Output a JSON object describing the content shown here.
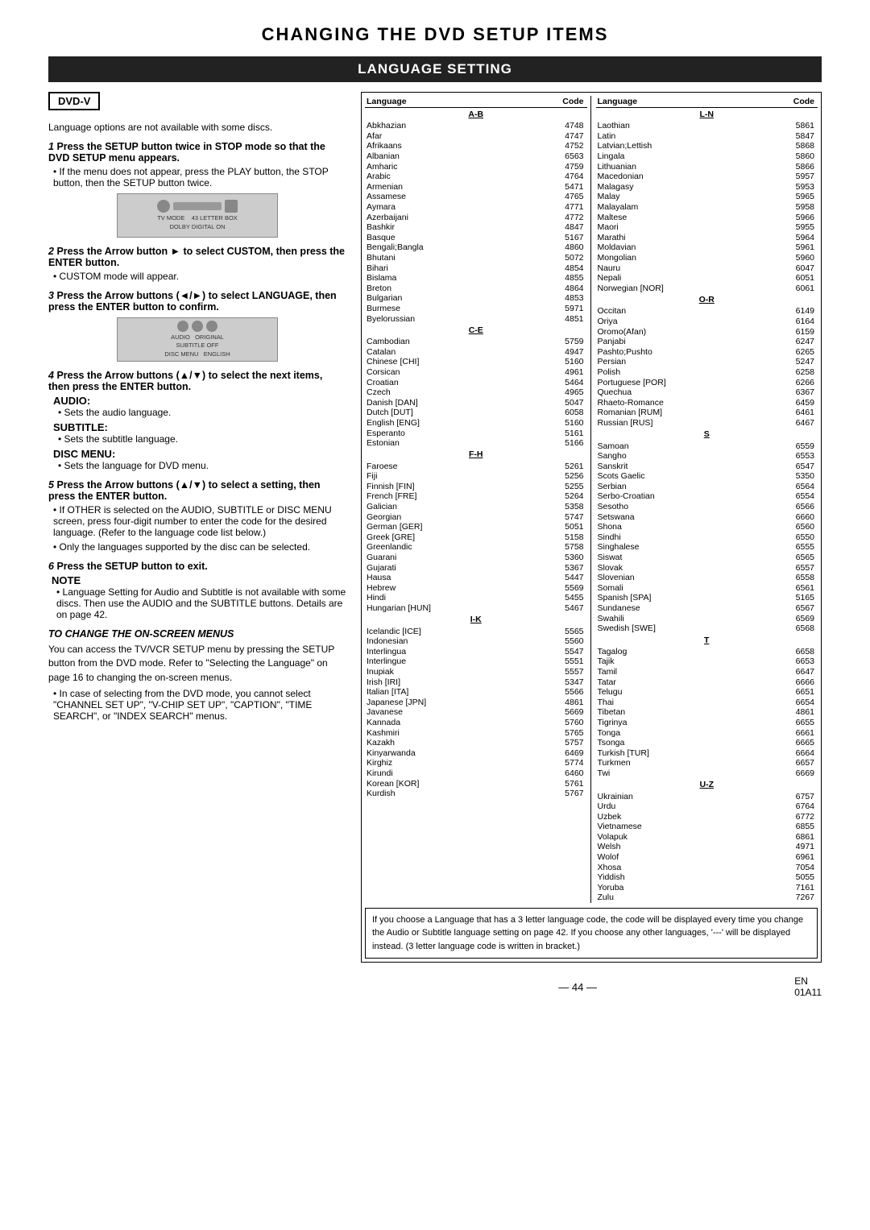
{
  "title": "CHANGING THE DVD SETUP ITEMS",
  "subtitle": "LANGUAGE SETTING",
  "dvd_badge": "DVD-V",
  "instruction_note": "Language options are not available with some discs.",
  "steps": [
    {
      "number": "1",
      "text": "Press the SETUP button twice in STOP mode so that the DVD SETUP menu appears.",
      "bullets": [
        "If the menu does not appear, press the PLAY button, the STOP button, then the SETUP button twice."
      ],
      "has_device1": true
    },
    {
      "number": "2",
      "text": "Press the Arrow button ► to select CUSTOM, then press the ENTER button.",
      "bullets": [
        "CUSTOM mode will appear."
      ]
    },
    {
      "number": "3",
      "text": "Press the Arrow buttons (◄/►) to select LANGUAGE, then press the ENTER button to confirm.",
      "has_device2": true
    },
    {
      "number": "4",
      "text": "Press the Arrow buttons (▲/▼) to select the next items, then press the ENTER button.",
      "section_labels": [
        {
          "label": "AUDIO:",
          "text": "Sets the audio language."
        },
        {
          "label": "SUBTITLE:",
          "text": "Sets the subtitle language."
        },
        {
          "label": "DISC MENU:",
          "text": "Sets the language for DVD menu."
        }
      ]
    },
    {
      "number": "5",
      "text": "Press the Arrow buttons (▲/▼) to select a setting, then press the ENTER button.",
      "bullets": [
        "If OTHER is selected on the AUDIO, SUBTITLE or DISC MENU screen, press four-digit number to enter the code for the desired language. (Refer to the language code list below.)",
        "Only the languages supported by the disc can be selected."
      ]
    },
    {
      "number": "6",
      "text": "Press the SETUP button to exit."
    }
  ],
  "note_title": "NOTE",
  "note_text": "Language Setting for Audio and Subtitle is not available with some discs. Then use the AUDIO and the SUBTITLE buttons. Details are on page 42.",
  "to_change_title": "TO CHANGE THE ON-SCREEN MENUS",
  "to_change_text": "You can access the TV/VCR SETUP menu by pressing the SETUP button from the DVD mode. Refer to \"Selecting the Language\" on page 16 to changing the on-screen menus.",
  "to_change_bullets": [
    "In case of selecting from the DVD mode, you cannot select \"CHANNEL SET UP\", \"V-CHIP SET UP\", \"CAPTION\", \"TIME SEARCH\", or \"INDEX SEARCH\" menus."
  ],
  "languages_left": {
    "header_lang": "Language",
    "header_code": "Code",
    "section_ab": "A-B",
    "rows_ab": [
      [
        "Abkhazian",
        "4748"
      ],
      [
        "Afar",
        "4747"
      ],
      [
        "Afrikaans",
        "4752"
      ],
      [
        "Albanian",
        "6563"
      ],
      [
        "Amharic",
        "4759"
      ],
      [
        "Arabic",
        "4764"
      ],
      [
        "Armenian",
        "5471"
      ],
      [
        "Assamese",
        "4765"
      ],
      [
        "Aymara",
        "4771"
      ],
      [
        "Azerbaijani",
        "4772"
      ],
      [
        "Bashkir",
        "4847"
      ],
      [
        "Basque",
        "5167"
      ],
      [
        "Bengali;Bangla",
        "4860"
      ],
      [
        "Bhutani",
        "5072"
      ],
      [
        "Bihari",
        "4854"
      ],
      [
        "Bislama",
        "4855"
      ],
      [
        "Breton",
        "4864"
      ],
      [
        "Bulgarian",
        "4853"
      ],
      [
        "Burmese",
        "5971"
      ],
      [
        "Byelorussian",
        "4851"
      ]
    ],
    "section_ce": "C-E",
    "rows_ce": [
      [
        "Cambodian",
        "5759"
      ],
      [
        "Catalan",
        "4947"
      ],
      [
        "Chinese [CHI]",
        "5160"
      ],
      [
        "Corsican",
        "4961"
      ],
      [
        "Croatian",
        "5464"
      ],
      [
        "Czech",
        "4965"
      ],
      [
        "Danish [DAN]",
        "5047"
      ],
      [
        "Dutch [DUT]",
        "6058"
      ],
      [
        "English [ENG]",
        "5160"
      ],
      [
        "Esperanto",
        "5161"
      ],
      [
        "Estonian",
        "5166"
      ]
    ],
    "section_fh": "F-H",
    "rows_fh": [
      [
        "Faroese",
        "5261"
      ],
      [
        "Fiji",
        "5256"
      ],
      [
        "Finnish [FIN]",
        "5255"
      ],
      [
        "French [FRE]",
        "5264"
      ],
      [
        "Galician",
        "5358"
      ],
      [
        "Georgian",
        "5747"
      ],
      [
        "German [GER]",
        "5051"
      ],
      [
        "Greek [GRE]",
        "5158"
      ],
      [
        "Greenlandic",
        "5758"
      ],
      [
        "Guarani",
        "5360"
      ],
      [
        "Gujarati",
        "5367"
      ],
      [
        "Hausa",
        "5447"
      ],
      [
        "Hebrew",
        "5569"
      ],
      [
        "Hindi",
        "5455"
      ],
      [
        "Hungarian [HUN]",
        "5467"
      ]
    ],
    "section_ik": "I-K",
    "rows_ik": [
      [
        "Icelandic [ICE]",
        "5565"
      ],
      [
        "Indonesian",
        "5560"
      ],
      [
        "Interlingua",
        "5547"
      ],
      [
        "Interlingue",
        "5551"
      ],
      [
        "Inupiak",
        "5557"
      ],
      [
        "Irish [IRI]",
        "5347"
      ],
      [
        "Italian [ITA]",
        "5566"
      ],
      [
        "Japanese [JPN]",
        "4861"
      ],
      [
        "Javanese",
        "5669"
      ],
      [
        "Kannada",
        "5760"
      ],
      [
        "Kashmiri",
        "5765"
      ],
      [
        "Kazakh",
        "5757"
      ],
      [
        "Kinyarwanda",
        "6469"
      ],
      [
        "Kirghiz",
        "5774"
      ],
      [
        "Kirundi",
        "6460"
      ],
      [
        "Korean [KOR]",
        "5761"
      ],
      [
        "Kurdish",
        "5767"
      ]
    ]
  },
  "languages_right": {
    "header_lang": "Language",
    "header_code": "Code",
    "section_ln": "L-N",
    "rows_ln": [
      [
        "Laothian",
        "5861"
      ],
      [
        "Latin",
        "5847"
      ],
      [
        "Latvian;Lettish",
        "5868"
      ],
      [
        "Lingala",
        "5860"
      ],
      [
        "Lithuanian",
        "5866"
      ],
      [
        "Macedonian",
        "5957"
      ],
      [
        "Malagasy",
        "5953"
      ],
      [
        "Malay",
        "5965"
      ],
      [
        "Malayalam",
        "5958"
      ],
      [
        "Maltese",
        "5966"
      ],
      [
        "Maori",
        "5955"
      ],
      [
        "Marathi",
        "5964"
      ],
      [
        "Moldavian",
        "5961"
      ],
      [
        "Mongolian",
        "5960"
      ],
      [
        "Nauru",
        "6047"
      ],
      [
        "Nepali",
        "6051"
      ],
      [
        "Norwegian [NOR]",
        "6061"
      ]
    ],
    "section_or": "O-R",
    "rows_or": [
      [
        "Occitan",
        "6149"
      ],
      [
        "Oriya",
        "6164"
      ],
      [
        "Oromo(Afan)",
        "6159"
      ],
      [
        "Panjabi",
        "6247"
      ],
      [
        "Pashto;Pushto",
        "6265"
      ],
      [
        "Persian",
        "5247"
      ],
      [
        "Polish",
        "6258"
      ],
      [
        "Portuguese [POR]",
        "6266"
      ],
      [
        "Quechua",
        "6367"
      ],
      [
        "Rhaeto-Romance",
        "6459"
      ],
      [
        "Romanian [RUM]",
        "6461"
      ],
      [
        "Russian [RUS]",
        "6467"
      ]
    ],
    "section_s": "S",
    "rows_s": [
      [
        "Samoan",
        "6559"
      ],
      [
        "Sangho",
        "6553"
      ],
      [
        "Sanskrit",
        "6547"
      ],
      [
        "Scots Gaelic",
        "5350"
      ],
      [
        "Serbian",
        "6564"
      ],
      [
        "Serbo-Croatian",
        "6554"
      ],
      [
        "Sesotho",
        "6566"
      ],
      [
        "Setswana",
        "6660"
      ],
      [
        "Shona",
        "6560"
      ],
      [
        "Sindhi",
        "6550"
      ],
      [
        "Singhalese",
        "6555"
      ],
      [
        "Siswat",
        "6565"
      ],
      [
        "Slovak",
        "6557"
      ],
      [
        "Slovenian",
        "6558"
      ],
      [
        "Somali",
        "6561"
      ],
      [
        "Spanish [SPA]",
        "5165"
      ],
      [
        "Sundanese",
        "6567"
      ],
      [
        "Swahili",
        "6569"
      ],
      [
        "Swedish [SWE]",
        "6568"
      ]
    ],
    "section_t": "T",
    "rows_t": [
      [
        "Tagalog",
        "6658"
      ],
      [
        "Tajik",
        "6653"
      ],
      [
        "Tamil",
        "6647"
      ],
      [
        "Tatar",
        "6666"
      ],
      [
        "Telugu",
        "6651"
      ],
      [
        "Thai",
        "6654"
      ],
      [
        "Tibetan",
        "4861"
      ],
      [
        "Tigrinya",
        "6655"
      ],
      [
        "Tonga",
        "6661"
      ],
      [
        "Tsonga",
        "6665"
      ],
      [
        "Turkish [TUR]",
        "6664"
      ],
      [
        "Turkmen",
        "6657"
      ],
      [
        "Twi",
        "6669"
      ]
    ],
    "section_uz": "U-Z",
    "rows_uz": [
      [
        "Ukrainian",
        "6757"
      ],
      [
        "Urdu",
        "6764"
      ],
      [
        "Uzbek",
        "6772"
      ],
      [
        "Vietnamese",
        "6855"
      ],
      [
        "Volapuk",
        "6861"
      ],
      [
        "Welsh",
        "4971"
      ],
      [
        "Wolof",
        "6961"
      ],
      [
        "Xhosa",
        "7054"
      ],
      [
        "Yiddish",
        "5055"
      ],
      [
        "Yoruba",
        "7161"
      ],
      [
        "Zulu",
        "7267"
      ]
    ]
  },
  "bottom_note": "If you choose a Language that has a 3 letter language code, the code will be displayed every time you change the Audio or Subtitle language setting on page 42. If you choose any other languages, '---' will be displayed instead. (3 letter language code is written in bracket.)",
  "page_number": "— 44 —",
  "en_label": "EN",
  "code_label": "01A11"
}
